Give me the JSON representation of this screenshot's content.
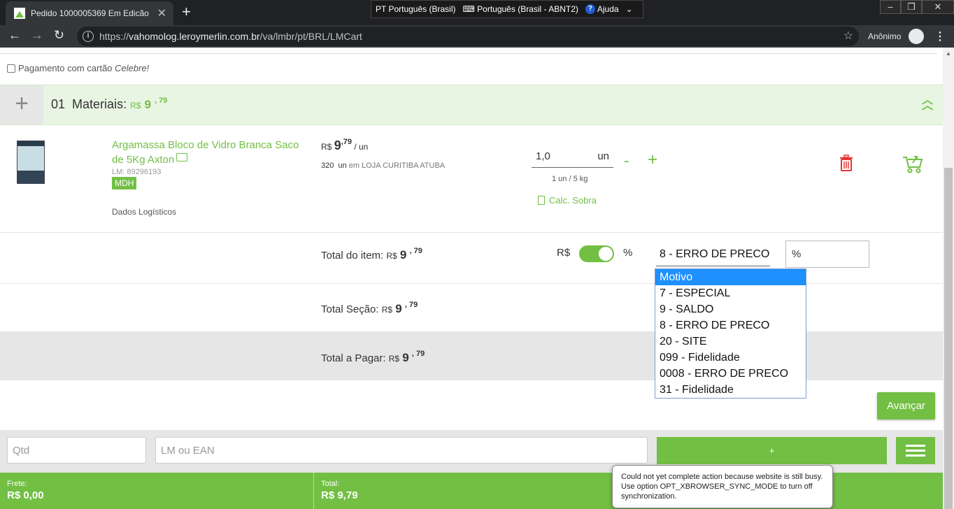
{
  "browser": {
    "tab_title": "Pedido  1000005369  Em Edicão",
    "tab_close": "✕",
    "new_tab": "+",
    "url_prefix": "https://",
    "url_host": "vahomolog.leroymerlin.com.br",
    "url_path": "/va/lmbr/pt/BRL/LMCart",
    "profile": "Anônimo",
    "language_bar": {
      "lang": "PT Português (Brasil)",
      "keyboard": "Português (Brasil - ABNT2)",
      "help": "Ajuda"
    }
  },
  "cartao": {
    "label": "Pagamento com cartão ",
    "brand": "Celebre!"
  },
  "section": {
    "number": "01",
    "title": "Materiais:",
    "currency": "R$",
    "price_int": "9",
    "price_cents": ", 79"
  },
  "product": {
    "name": "Argamassa Bloco de Vidro Branca Saco de 5Kg Axton",
    "lm": "LM: 89296193",
    "badge": "MDH",
    "logistics": "Dados Logísticos",
    "currency": "R$",
    "unit_price_int": "9",
    "unit_price_cents": ",79",
    "unit": "/ un",
    "stock_qty": "320",
    "stock_unit": "un",
    "stock_location": "em LOJA CURITIBA ATUBA",
    "quantity": "1,0",
    "quantity_unit": "un",
    "minus": "-",
    "plus": "+",
    "pack_info": "1 un / 5  kg",
    "calc_label": "Calc. Sobra"
  },
  "item_total": {
    "label": "Total do item:",
    "currency": "R$",
    "int": "9",
    "cents": ", 79",
    "rs_label": "R$",
    "pct_label": "%",
    "toggle_on": true,
    "motivo_value": "8 - ERRO DE PRECO",
    "pct_placeholder": "%"
  },
  "section_total": {
    "label": "Total Seção:",
    "currency": "R$",
    "int": "9",
    "cents": ", 79"
  },
  "pay_total": {
    "label": "Total a Pagar:",
    "currency": "R$",
    "int": "9",
    "cents": ", 79"
  },
  "avancar": "Avançar",
  "add_bar": {
    "qtd_placeholder": "Qtd",
    "lm_placeholder": "LM ou EAN",
    "add_label": "+"
  },
  "footer": {
    "frete_label": "Frete:",
    "frete_value": "R$ 0,00",
    "total_label": "Total:",
    "total_value": "R$ 9,79"
  },
  "dropdown": {
    "options": [
      "Motivo",
      "7 - ESPECIAL",
      "9 - SALDO",
      "8 - ERRO DE PRECO",
      "20 - SITE",
      "099 - Fidelidade",
      "0008 - ERRO DE PRECO",
      "31 - Fidelidade"
    ],
    "selected_index": 0
  },
  "tooltip": "Could not yet complete action because website is still busy. Use option OPT_XBROWSER_SYNC_MODE to turn off synchronization.",
  "colors": {
    "brand_green": "#72bf44",
    "danger_red": "#e53935",
    "select_blue": "#1e90ff"
  }
}
